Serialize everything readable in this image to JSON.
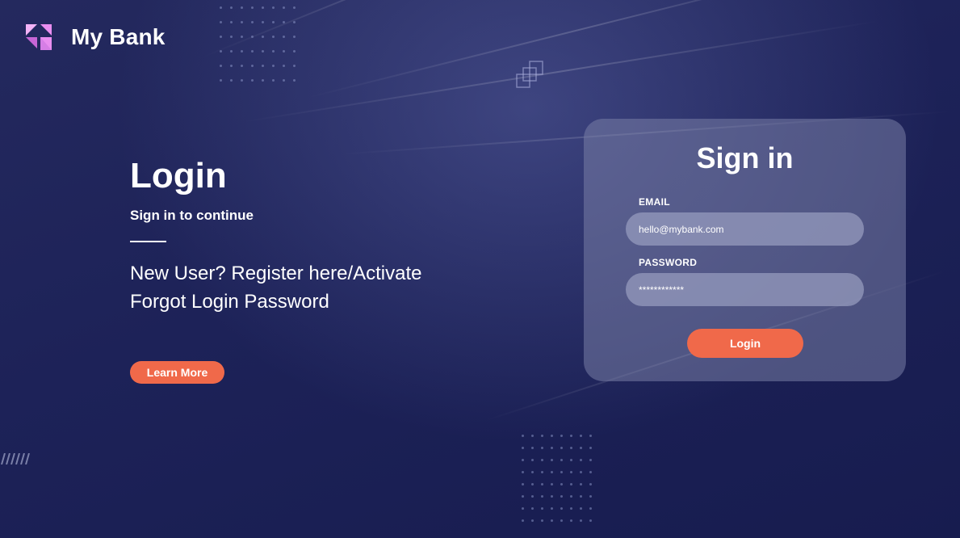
{
  "brand": {
    "name": "My Bank",
    "logo_icon": "triangles-logo-icon",
    "logo_color": "#e98ef0"
  },
  "hero": {
    "title": "Login",
    "subtitle": "Sign in to continue",
    "line1": "New User? Register here/Activate",
    "line2": "Forgot Login Password",
    "learn_more_label": "Learn More"
  },
  "signin": {
    "title": "Sign in",
    "email_label": "EMAIL",
    "email_value": "hello@mybank.com",
    "password_label": "PASSWORD",
    "password_value": "************",
    "login_label": "Login"
  },
  "colors": {
    "accent": "#f0694a",
    "background": "#1d2258",
    "card": "#787da5"
  }
}
